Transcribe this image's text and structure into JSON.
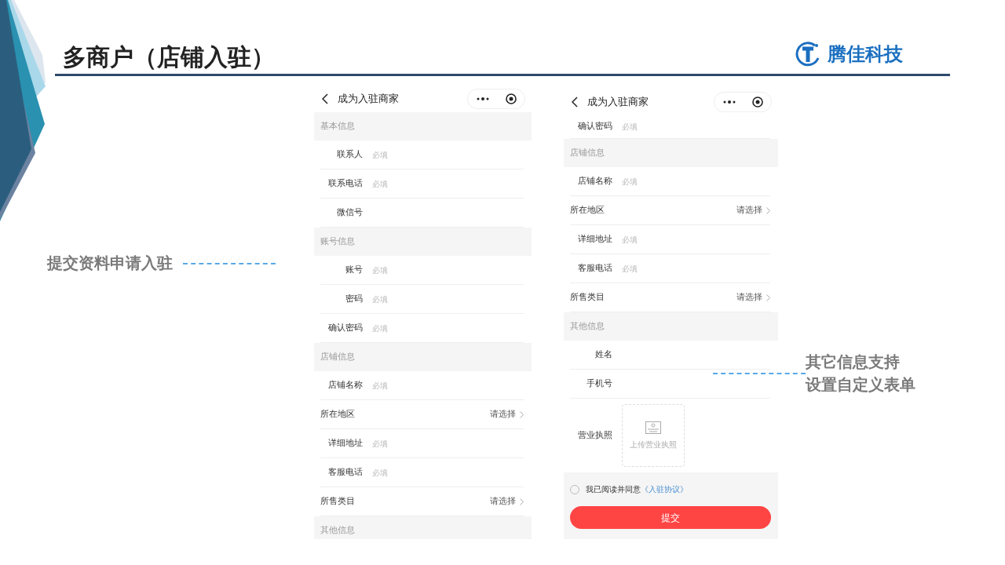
{
  "slide": {
    "title": "多商户（店铺入驻）",
    "logo_text": "腾佳科技"
  },
  "callouts": [
    {
      "lines": [
        "提交资料申请入驻"
      ]
    },
    {
      "lines": [
        "其它信息支持",
        "设置自定义表单"
      ]
    }
  ],
  "phones": [
    {
      "title": "成为入驻商家",
      "rows": [
        {
          "kind": "section",
          "label": "基本信息"
        },
        {
          "kind": "field",
          "label": "联系人",
          "placeholder": "必填"
        },
        {
          "kind": "field",
          "label": "联系电话",
          "placeholder": "必填"
        },
        {
          "kind": "field",
          "label": "微信号"
        },
        {
          "kind": "section",
          "label": "账号信息"
        },
        {
          "kind": "field",
          "label": "账号",
          "placeholder": "必填"
        },
        {
          "kind": "field",
          "label": "密码",
          "placeholder": "必填"
        },
        {
          "kind": "field",
          "label": "确认密码",
          "placeholder": "必填"
        },
        {
          "kind": "section",
          "label": "店铺信息"
        },
        {
          "kind": "field",
          "label": "店铺名称",
          "placeholder": "必填"
        },
        {
          "kind": "select",
          "label": "所在地区",
          "value": "请选择"
        },
        {
          "kind": "field",
          "label": "详细地址",
          "placeholder": "必填"
        },
        {
          "kind": "field",
          "label": "客服电话",
          "placeholder": "必填"
        },
        {
          "kind": "select",
          "label": "所售类目",
          "value": "请选择"
        },
        {
          "kind": "section",
          "label": "其他信息"
        }
      ]
    },
    {
      "title": "成为入驻商家",
      "rows": [
        {
          "kind": "field",
          "label": "确认密码",
          "placeholder": "必填"
        },
        {
          "kind": "section",
          "label": "店铺信息"
        },
        {
          "kind": "field",
          "label": "店铺名称",
          "placeholder": "必填"
        },
        {
          "kind": "select",
          "label": "所在地区",
          "value": "请选择"
        },
        {
          "kind": "field",
          "label": "详细地址",
          "placeholder": "必填"
        },
        {
          "kind": "field",
          "label": "客服电话",
          "placeholder": "必填"
        },
        {
          "kind": "select",
          "label": "所售类目",
          "value": "请选择"
        },
        {
          "kind": "section",
          "label": "其他信息"
        },
        {
          "kind": "field",
          "label": "姓名"
        },
        {
          "kind": "field",
          "label": "手机号"
        },
        {
          "kind": "upload",
          "label": "营业执照",
          "caption": "上传营业执照"
        },
        {
          "kind": "agree",
          "text": "我已阅读并同意",
          "link": "《入驻协议》",
          "checked": false
        },
        {
          "kind": "button",
          "label": "提交"
        }
      ]
    }
  ]
}
